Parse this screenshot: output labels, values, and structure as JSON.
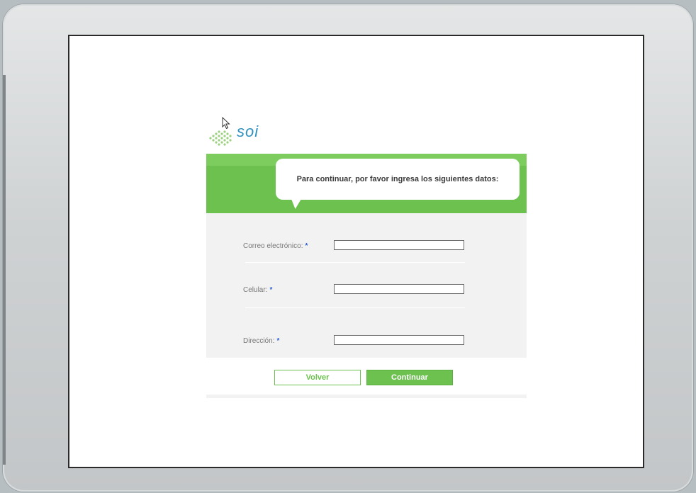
{
  "logo": {
    "text": "soi"
  },
  "banner": {
    "message": "Para continuar, por favor ingresa los siguientes datos:"
  },
  "form": {
    "fields": [
      {
        "label": "Correo electrónico:",
        "required_mark": "*",
        "value": ""
      },
      {
        "label": "Celular:",
        "required_mark": "*",
        "value": ""
      },
      {
        "label": "Dirección:",
        "required_mark": "*",
        "value": ""
      }
    ]
  },
  "buttons": {
    "back": "Volver",
    "continue": "Continuar"
  },
  "colors": {
    "brand_green": "#6cc14f",
    "logo_blue": "#2f8fbf",
    "required_blue": "#2a5bd7"
  }
}
